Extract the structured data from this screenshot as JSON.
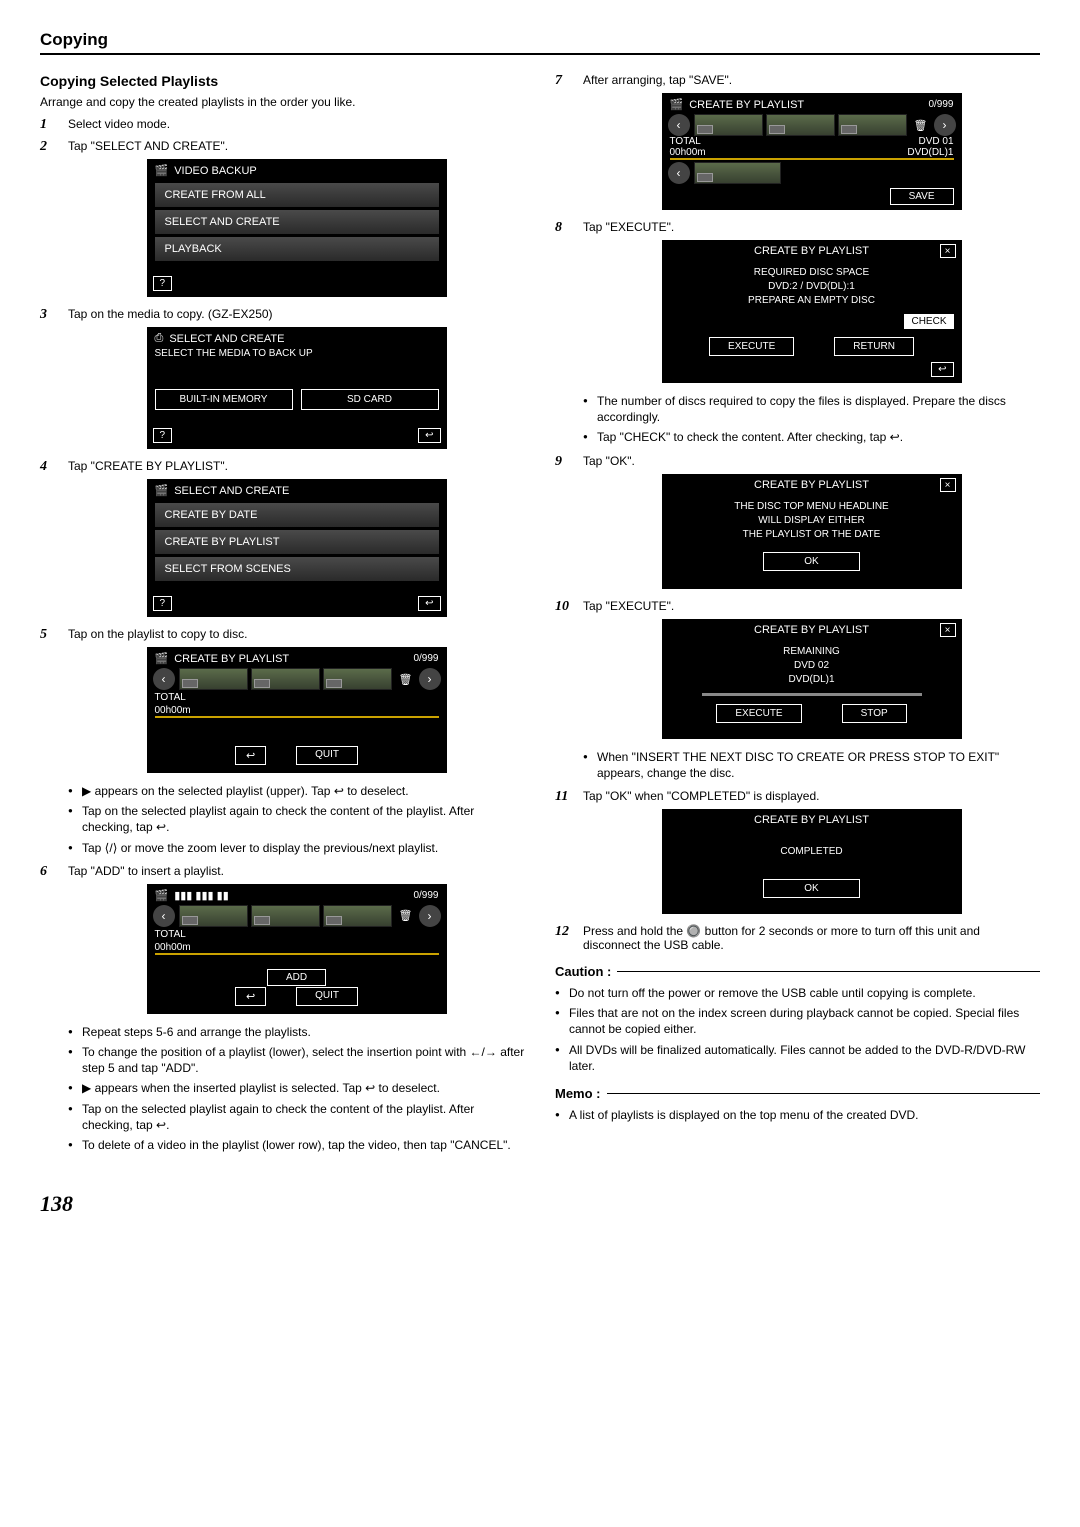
{
  "page": {
    "title": "Copying",
    "number": "138"
  },
  "section": {
    "subtitle": "Copying Selected Playlists",
    "intro": "Arrange and copy the created playlists in the order you like."
  },
  "steps": {
    "s1": "Select video mode.",
    "s2": "Tap \"SELECT AND CREATE\".",
    "s3": "Tap on the media to copy. (GZ-EX250)",
    "s4": "Tap \"CREATE BY PLAYLIST\".",
    "s5": "Tap on the playlist to copy to disc.",
    "s6": "Tap \"ADD\" to insert a playlist.",
    "s7": "After arranging, tap \"SAVE\".",
    "s8": "Tap \"EXECUTE\".",
    "s9": "Tap \"OK\".",
    "s10": "Tap \"EXECUTE\".",
    "s11": "Tap \"OK\" when \"COMPLETED\" is displayed.",
    "s12": "Press and hold the 🔘 button for 2 seconds or more to turn off this unit and disconnect the USB cable."
  },
  "screen1": {
    "title": "VIDEO BACKUP",
    "m1": "CREATE FROM ALL",
    "m2": "SELECT AND CREATE",
    "m3": "PLAYBACK",
    "help": "?"
  },
  "screen2": {
    "title": "SELECT AND CREATE",
    "sub": "SELECT THE MEDIA TO BACK UP",
    "b1": "BUILT-IN MEMORY",
    "b2": "SD CARD",
    "help": "?",
    "back": "↩"
  },
  "screen3": {
    "title": "SELECT AND CREATE",
    "m1": "CREATE BY DATE",
    "m2": "CREATE BY PLAYLIST",
    "m3": "SELECT FROM SCENES",
    "help": "?",
    "back": "↩"
  },
  "screen4": {
    "title": "CREATE BY PLAYLIST",
    "counter": "0/999",
    "total": "TOTAL",
    "time": "00h00m",
    "quit": "QUIT",
    "back": "↩"
  },
  "screen5": {
    "counter": "0/999",
    "total": "TOTAL",
    "time": "00h00m",
    "add": "ADD",
    "quit": "QUIT",
    "back": "↩"
  },
  "screen6": {
    "title": "CREATE BY PLAYLIST",
    "counter": "0/999",
    "total": "TOTAL",
    "time": "00h00m",
    "dvd": "DVD   01",
    "dvddl": "DVD(DL)1",
    "save": "SAVE"
  },
  "screen7": {
    "title": "CREATE BY PLAYLIST",
    "l1": "REQUIRED DISC SPACE",
    "l2": "DVD:2 / DVD(DL):1",
    "l3": "PREPARE AN EMPTY DISC",
    "check": "CHECK",
    "execute": "EXECUTE",
    "ret": "RETURN",
    "back": "↩"
  },
  "screen8": {
    "title": "CREATE BY PLAYLIST",
    "l1": "THE DISC TOP MENU HEADLINE",
    "l2": "WILL DISPLAY EITHER",
    "l3": "THE PLAYLIST OR THE DATE",
    "ok": "OK"
  },
  "screen9": {
    "title": "CREATE BY PLAYLIST",
    "l1": "REMAINING",
    "l2": "DVD    02",
    "l3": "DVD(DL)1",
    "execute": "EXECUTE",
    "stop": "STOP"
  },
  "screen10": {
    "title": "CREATE BY PLAYLIST",
    "msg": "COMPLETED",
    "ok": "OK"
  },
  "notes5": {
    "n1": "▶ appears on the selected playlist (upper). Tap ↩ to deselect.",
    "n2": "Tap on the selected playlist again to check the content of the playlist. After checking, tap ↩.",
    "n3": "Tap ⟨/⟩ or move the zoom lever to display the previous/next playlist."
  },
  "notes6": {
    "n1": "Repeat steps 5-6 and arrange the playlists.",
    "n2": "To change the position of a playlist (lower), select the insertion point with ←/→ after step 5 and tap \"ADD\".",
    "n3": "▶ appears when the inserted playlist is selected. Tap ↩ to deselect.",
    "n4": "Tap on the selected playlist again to check the content of the playlist. After checking, tap ↩.",
    "n5": "To delete of a video in the playlist (lower row), tap the video, then tap \"CANCEL\"."
  },
  "notes8": {
    "n1": "The number of discs required to copy the files is displayed. Prepare the discs accordingly.",
    "n2": "Tap \"CHECK\" to check the content. After checking, tap ↩."
  },
  "notes10": {
    "n1": "When \"INSERT THE NEXT DISC TO CREATE OR PRESS STOP TO EXIT\" appears, change the disc."
  },
  "caution": {
    "heading": "Caution :",
    "c1": "Do not turn off the power or remove the USB cable until copying is complete.",
    "c2": "Files that are not on the index screen during playback cannot be copied. Special files cannot be copied either.",
    "c3": "All DVDs will be finalized automatically. Files cannot be added to the DVD-R/DVD-RW later."
  },
  "memo": {
    "heading": "Memo :",
    "m1": "A list of playlists is displayed on the top menu of the created DVD."
  }
}
